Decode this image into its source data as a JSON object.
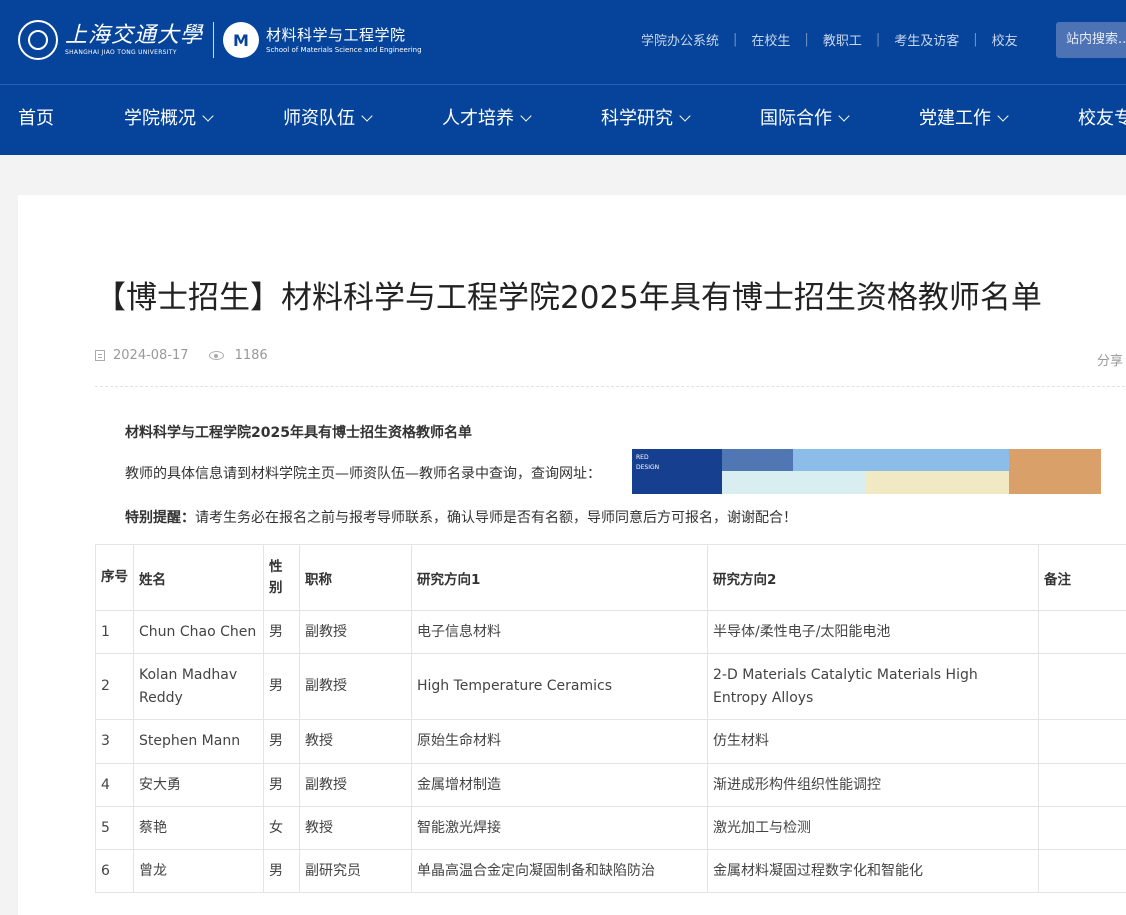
{
  "header": {
    "university_cn": "上海交通大學",
    "university_en": "SHANGHAI JIAO TONG UNIVERSITY",
    "school_cn": "材料科学与工程学院",
    "school_en": "School of Materials Science and Engineering",
    "top_links": [
      "学院办公系统",
      "在校生",
      "教职工",
      "考生及访客",
      "校友"
    ],
    "search_label": "站内搜索..."
  },
  "nav": {
    "items": [
      {
        "label": "首页",
        "has_dropdown": false
      },
      {
        "label": "学院概况",
        "has_dropdown": true
      },
      {
        "label": "师资队伍",
        "has_dropdown": true
      },
      {
        "label": "人才培养",
        "has_dropdown": true
      },
      {
        "label": "科学研究",
        "has_dropdown": true
      },
      {
        "label": "国际合作",
        "has_dropdown": true
      },
      {
        "label": "党建工作",
        "has_dropdown": true
      },
      {
        "label": "校友专",
        "has_dropdown": false
      }
    ]
  },
  "article": {
    "title": "【博士招生】材料科学与工程学院2025年具有博士招生资格教师名单",
    "date": "2024-08-17",
    "views": "1186",
    "share_label": "分享",
    "heading": "材料科学与工程学院2025年具有博士招生资格教师名单",
    "info_text": "教师的具体信息请到材料学院主页—师资队伍—教师名录中查询，查询网址：",
    "banner_text": "RED\nDESIGN",
    "note_label": "特别提醒：",
    "note_text": "请考生务必在报名之前与报考导师联系，确认导师是否有名额，导师同意后方可报名，谢谢配合！"
  },
  "table": {
    "headers": [
      "序号",
      "姓名",
      "性别",
      "职称",
      "研究方向1",
      "研究方向2",
      "备注"
    ],
    "rows": [
      [
        "1",
        "Chun Chao Chen",
        "男",
        "副教授",
        "电子信息材料",
        "半导体/柔性电子/太阳能电池",
        ""
      ],
      [
        "2",
        "Kolan Madhav Reddy",
        "男",
        "副教授",
        "High Temperature Ceramics",
        "2-D Materials Catalytic Materials High Entropy Alloys",
        ""
      ],
      [
        "3",
        "Stephen Mann",
        "男",
        "教授",
        "原始生命材料",
        "仿生材料",
        ""
      ],
      [
        "4",
        "安大勇",
        "男",
        "副教授",
        "金属增材制造",
        "渐进成形构件组织性能调控",
        ""
      ],
      [
        "5",
        "蔡艳",
        "女",
        "教授",
        "智能激光焊接",
        "激光加工与检测",
        ""
      ],
      [
        "6",
        "曾龙",
        "男",
        "副研究员",
        "单晶高温合金定向凝固制备和缺陷防治",
        "金属材料凝固过程数字化和智能化",
        ""
      ]
    ]
  },
  "colors": {
    "brand_blue": "#05449a",
    "search_bg": "#4d73b5"
  }
}
